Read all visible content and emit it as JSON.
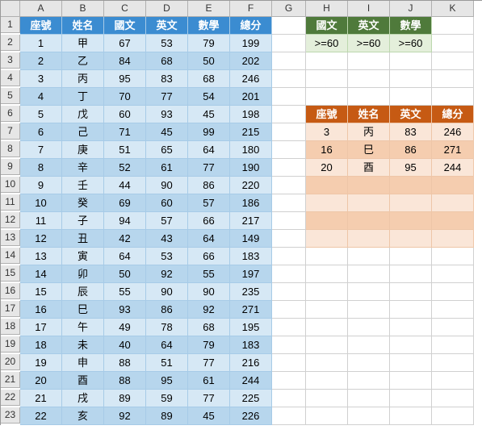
{
  "columns": [
    "A",
    "B",
    "C",
    "D",
    "E",
    "F",
    "G",
    "H",
    "I",
    "J",
    "K"
  ],
  "rowcount": 23,
  "main": {
    "headers": [
      "座號",
      "姓名",
      "國文",
      "英文",
      "數學",
      "總分"
    ],
    "rows": [
      [
        1,
        "甲",
        67,
        53,
        79,
        199
      ],
      [
        2,
        "乙",
        84,
        68,
        50,
        202
      ],
      [
        3,
        "丙",
        95,
        83,
        68,
        246
      ],
      [
        4,
        "丁",
        70,
        77,
        54,
        201
      ],
      [
        5,
        "戊",
        60,
        93,
        45,
        198
      ],
      [
        6,
        "己",
        71,
        45,
        99,
        215
      ],
      [
        7,
        "庚",
        51,
        65,
        64,
        180
      ],
      [
        8,
        "辛",
        52,
        61,
        77,
        190
      ],
      [
        9,
        "壬",
        44,
        90,
        86,
        220
      ],
      [
        10,
        "癸",
        69,
        60,
        57,
        186
      ],
      [
        11,
        "子",
        94,
        57,
        66,
        217
      ],
      [
        12,
        "丑",
        42,
        43,
        64,
        149
      ],
      [
        13,
        "寅",
        64,
        53,
        66,
        183
      ],
      [
        14,
        "卯",
        50,
        92,
        55,
        197
      ],
      [
        15,
        "辰",
        55,
        90,
        90,
        235
      ],
      [
        16,
        "巳",
        93,
        86,
        92,
        271
      ],
      [
        17,
        "午",
        49,
        78,
        68,
        195
      ],
      [
        18,
        "未",
        40,
        64,
        79,
        183
      ],
      [
        19,
        "申",
        88,
        51,
        77,
        216
      ],
      [
        20,
        "酉",
        88,
        95,
        61,
        244
      ],
      [
        21,
        "戌",
        89,
        59,
        77,
        225
      ],
      [
        22,
        "亥",
        92,
        89,
        45,
        226
      ]
    ]
  },
  "criteria": {
    "headers": [
      "國文",
      "英文",
      "數學"
    ],
    "values": [
      ">=60",
      ">=60",
      ">=60"
    ]
  },
  "result": {
    "headers": [
      "座號",
      "姓名",
      "英文",
      "總分"
    ],
    "rows": [
      [
        3,
        "丙",
        83,
        246
      ],
      [
        16,
        "巳",
        86,
        271
      ],
      [
        20,
        "酉",
        95,
        244
      ]
    ],
    "emptyRows": 4
  }
}
